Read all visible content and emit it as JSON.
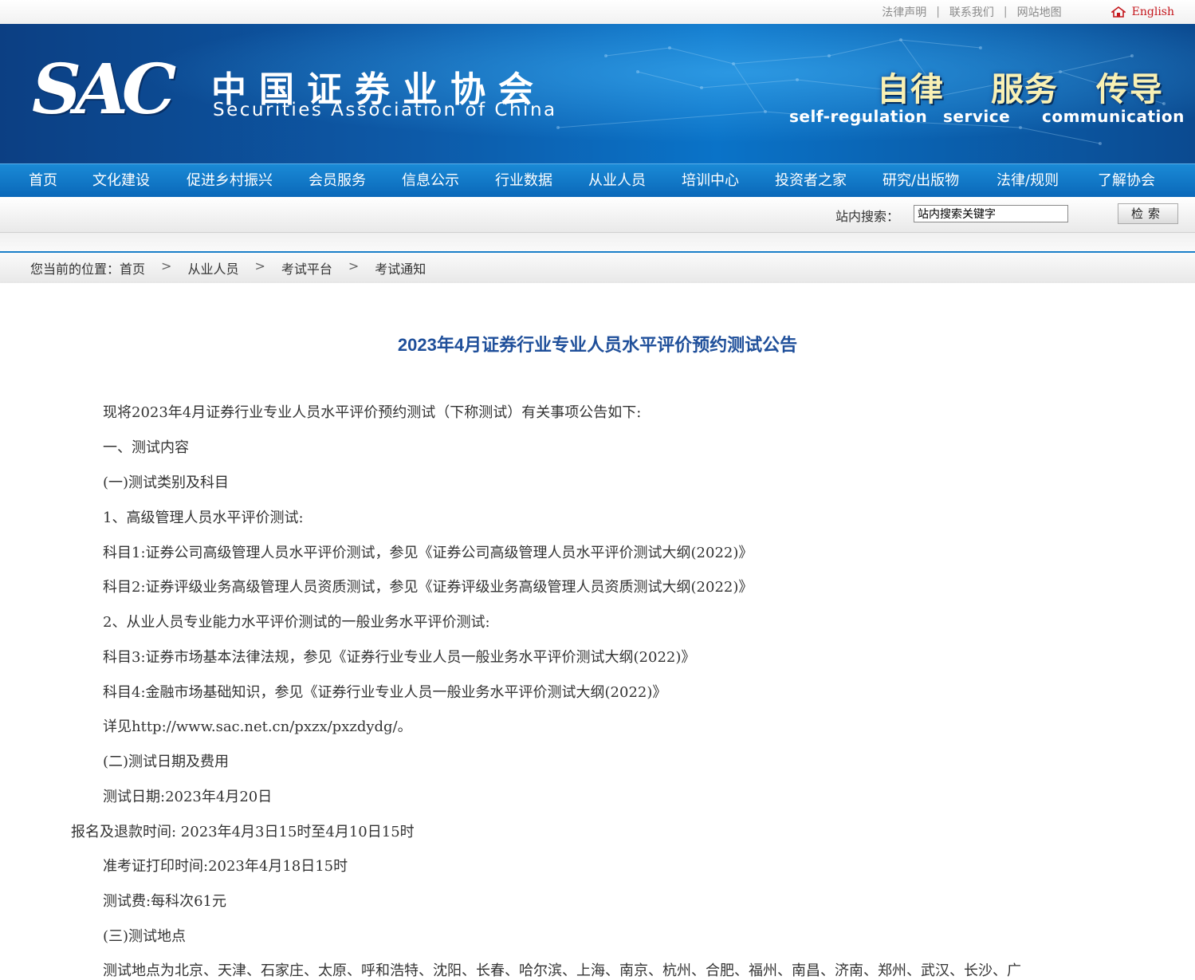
{
  "topbar": {
    "links": [
      "法律声明",
      "联系我们",
      "网站地图"
    ],
    "separator": "|",
    "english": "English"
  },
  "banner": {
    "logo": "SAC",
    "cn_title": "中国证券业协会",
    "en_title": "Securities Association of China",
    "slogans": [
      {
        "cn": "自律",
        "en": "self-regulation"
      },
      {
        "cn": "服务",
        "en": "service"
      },
      {
        "cn": "传导",
        "en": "communication"
      }
    ]
  },
  "nav": {
    "items": [
      "首页",
      "文化建设",
      "促进乡村振兴",
      "会员服务",
      "信息公示",
      "行业数据",
      "从业人员",
      "培训中心",
      "投资者之家",
      "研究/出版物",
      "法律/规则",
      "了解协会"
    ]
  },
  "search": {
    "label": "站内搜索：",
    "placeholder": "站内搜索关键字",
    "button": "检索"
  },
  "breadcrumb": {
    "prefix": "您当前的位置：",
    "items": [
      "首页",
      "从业人员",
      "考试平台",
      "考试通知"
    ],
    "separator": ">"
  },
  "article": {
    "title": "2023年4月证券行业专业人员水平评价预约测试公告",
    "paragraphs": [
      "现将2023年4月证券行业专业人员水平评价预约测试（下称测试）有关事项公告如下:",
      "一、测试内容",
      "(一)测试类别及科目",
      "1、高级管理人员水平评价测试:",
      "科目1:证券公司高级管理人员水平评价测试，参见《证券公司高级管理人员水平评价测试大纲(2022)》",
      "科目2:证券评级业务高级管理人员资质测试，参见《证券评级业务高级管理人员资质测试大纲(2022)》",
      "2、从业人员专业能力水平评价测试的一般业务水平评价测试:",
      "科目3:证券市场基本法律法规，参见《证券行业专业人员一般业务水平评价测试大纲(2022)》",
      "科目4:金融市场基础知识，参见《证券行业专业人员一般业务水平评价测试大纲(2022)》",
      "详见http://www.sac.net.cn/pxzx/pxzdydg/。",
      "(二)测试日期及费用",
      "测试日期:2023年4月20日",
      "报名及退款时间: 2023年4月3日15时至4月10日15时",
      "准考证打印时间:2023年4月18日15时",
      "测试费:每科次61元",
      "(三)测试地点",
      "测试地点为北京、天津、石家庄、太原、呼和浩特、沈阳、长春、哈尔滨、上海、南京、杭州、合肥、福州、南昌、济南、郑州、武汉、长沙、广"
    ]
  },
  "colors": {
    "nav_bg": "#0f78c6",
    "title": "#1f4f9a",
    "english_link": "#c4161c"
  }
}
